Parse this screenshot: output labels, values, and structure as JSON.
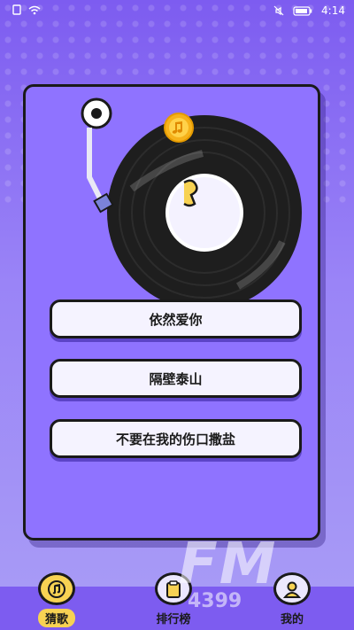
{
  "status_bar": {
    "time": "4:14"
  },
  "quiz": {
    "options": [
      "依然爱你",
      "隔壁泰山",
      "不要在我的伤口撒盐"
    ]
  },
  "tabs": [
    {
      "label": "猜歌",
      "icon": "music-note-icon",
      "active": true
    },
    {
      "label": "排行榜",
      "icon": "leaderboard-icon",
      "active": false
    },
    {
      "label": "我的",
      "icon": "user-icon",
      "active": false
    }
  ],
  "watermark": {
    "big": "FM",
    "small": "4399"
  },
  "colors": {
    "background": "#7d5cf0",
    "card": "#8f73ff",
    "active_tab": "#f7d253",
    "record": "#1e1e1e"
  }
}
